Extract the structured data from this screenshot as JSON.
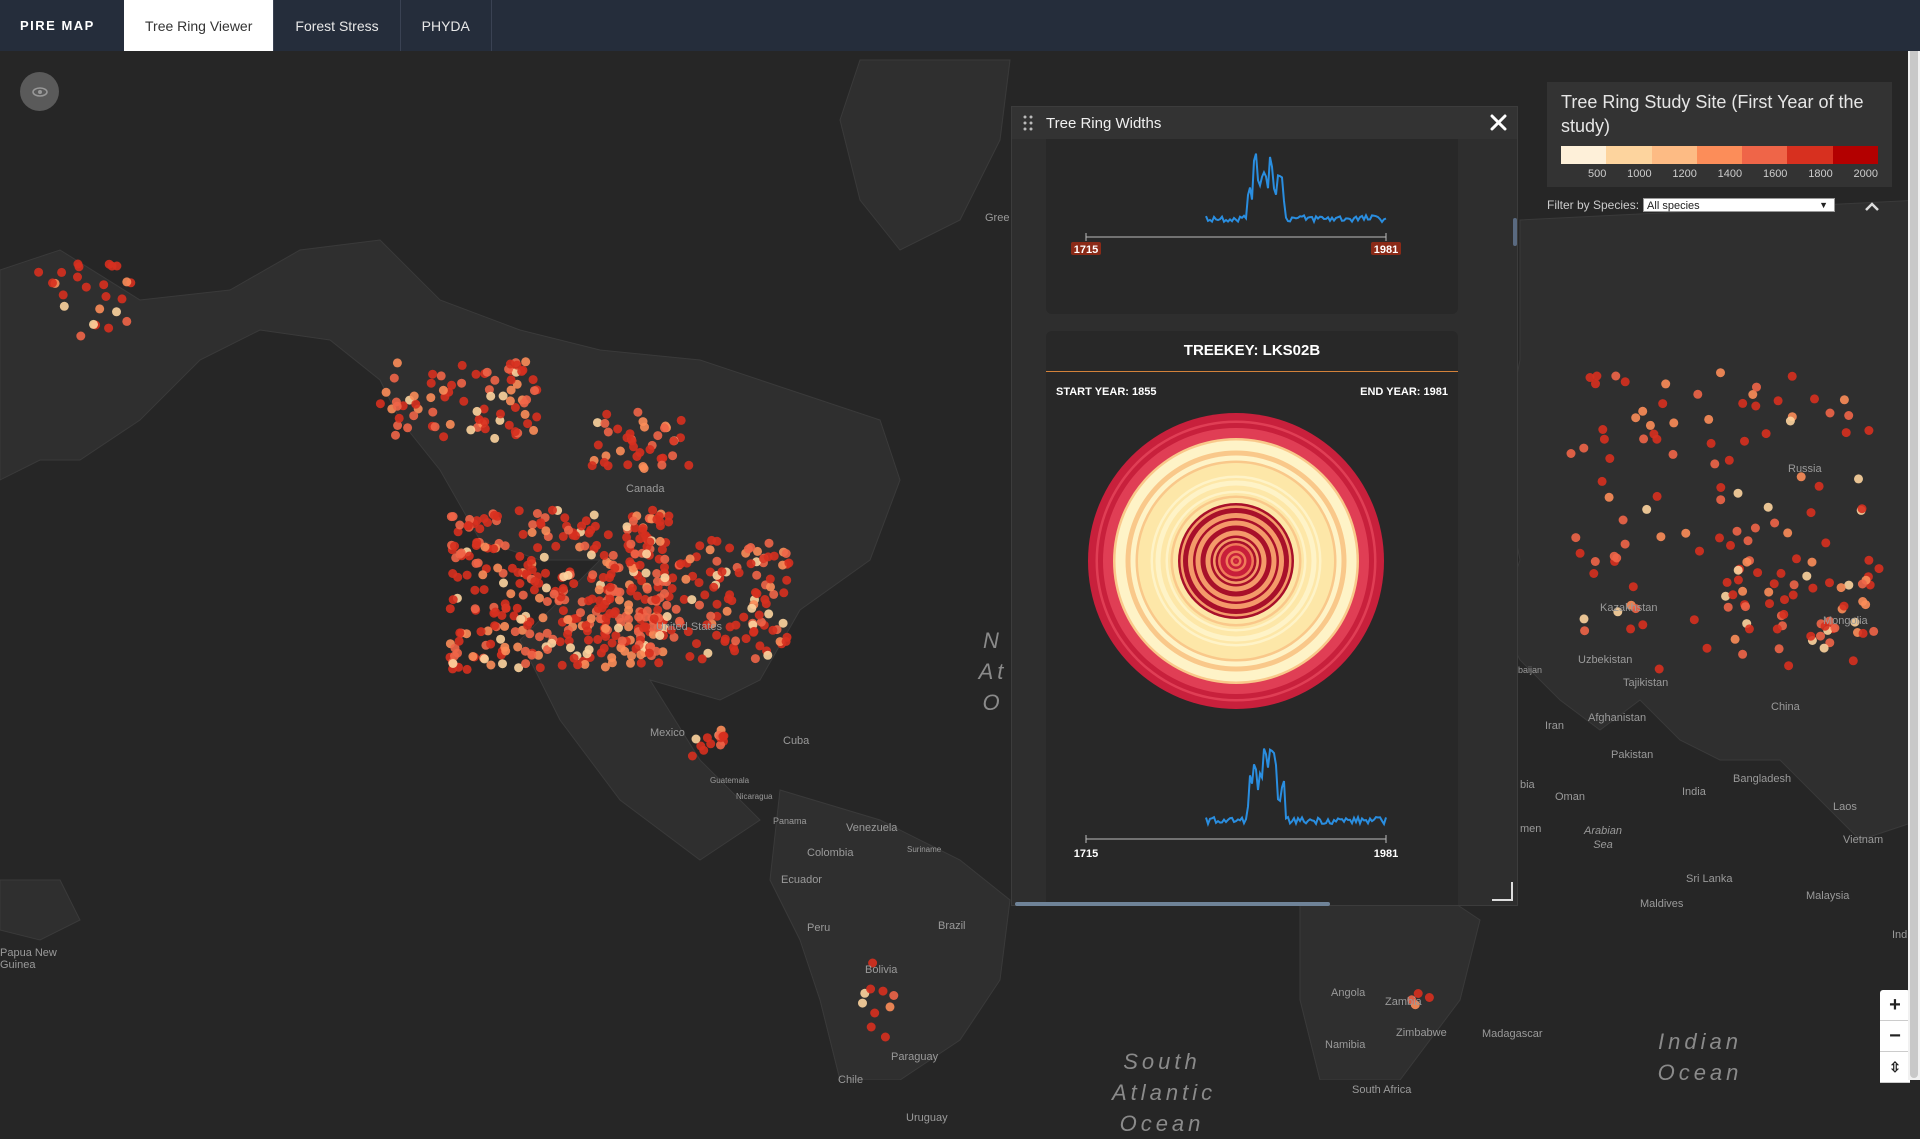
{
  "nav": {
    "brand": "PIRE MAP",
    "tabs": [
      {
        "label": "Tree Ring Viewer",
        "active": true
      },
      {
        "label": "Forest Stress",
        "active": false
      },
      {
        "label": "PHYDA",
        "active": false
      }
    ]
  },
  "map": {
    "labels": [
      {
        "text": "Gree"
      },
      {
        "text": "Canada"
      },
      {
        "text": "United States"
      },
      {
        "text": "Mexico"
      },
      {
        "text": "Cuba"
      },
      {
        "text": "Guatemala"
      },
      {
        "text": "Nicaragua"
      },
      {
        "text": "Panama"
      },
      {
        "text": "Venezuela"
      },
      {
        "text": "Colombia"
      },
      {
        "text": "Suriname"
      },
      {
        "text": "Ecuador"
      },
      {
        "text": "Peru"
      },
      {
        "text": "Brazil"
      },
      {
        "text": "Bolivia"
      },
      {
        "text": "Paraguay"
      },
      {
        "text": "Chile"
      },
      {
        "text": "Uruguay"
      },
      {
        "text": "Papua New Guinea"
      },
      {
        "text": "Russia"
      },
      {
        "text": "Kazakhstan"
      },
      {
        "text": "Uzbekistan"
      },
      {
        "text": "Tajikistan"
      },
      {
        "text": "Mongolia"
      },
      {
        "text": "Afghanistan"
      },
      {
        "text": "China"
      },
      {
        "text": "Iran"
      },
      {
        "text": "Pakistan"
      },
      {
        "text": "Bangladesh"
      },
      {
        "text": "India"
      },
      {
        "text": "Oman"
      },
      {
        "text": "Laos"
      },
      {
        "text": "Vietnam"
      },
      {
        "text": "Sri Lanka"
      },
      {
        "text": "Malaysia"
      },
      {
        "text": "Maldives"
      },
      {
        "text": "Angola"
      },
      {
        "text": "Zambia"
      },
      {
        "text": "Zimbabwe"
      },
      {
        "text": "Namibia"
      },
      {
        "text": "Madagascar"
      },
      {
        "text": "South Africa"
      },
      {
        "text": "Arabian Sea"
      },
      {
        "text": "Ind"
      },
      {
        "text": "baijan"
      },
      {
        "text": "bia"
      },
      {
        "text": "men"
      }
    ],
    "oceans": [
      {
        "text": "North Atlantic Ocean",
        "shown": "N At O"
      },
      {
        "text": "South Atlantic Ocean"
      },
      {
        "text": "Indian Ocean"
      }
    ]
  },
  "panel": {
    "title": "Tree Ring Widths",
    "close_icon": "close-icon",
    "drag_icon": "drag-handle-icon",
    "cards": [
      {
        "axis_start": "1715",
        "axis_end": "1981"
      },
      {
        "title": "TREEKEY: LKS02B",
        "start_label": "START YEAR: 1855",
        "end_label": "END YEAR: 1981",
        "axis_start": "1715",
        "axis_end": "1981"
      }
    ],
    "series_color": "#2a8ee0",
    "accent": "#d4823a"
  },
  "legend": {
    "title": "Tree Ring Study Site (First Year of the study)",
    "colors": [
      "#fef0d9",
      "#fdd49e",
      "#fdbb84",
      "#fc8d59",
      "#ef6548",
      "#d7301f",
      "#b30000"
    ],
    "ticks": [
      "500",
      "1000",
      "1200",
      "1400",
      "1600",
      "1800",
      "2000"
    ],
    "filter_label": "Filter by Species:",
    "filter_value": "All species"
  },
  "zoom": {
    "in": "+",
    "out": "−",
    "reset": "⇳"
  }
}
